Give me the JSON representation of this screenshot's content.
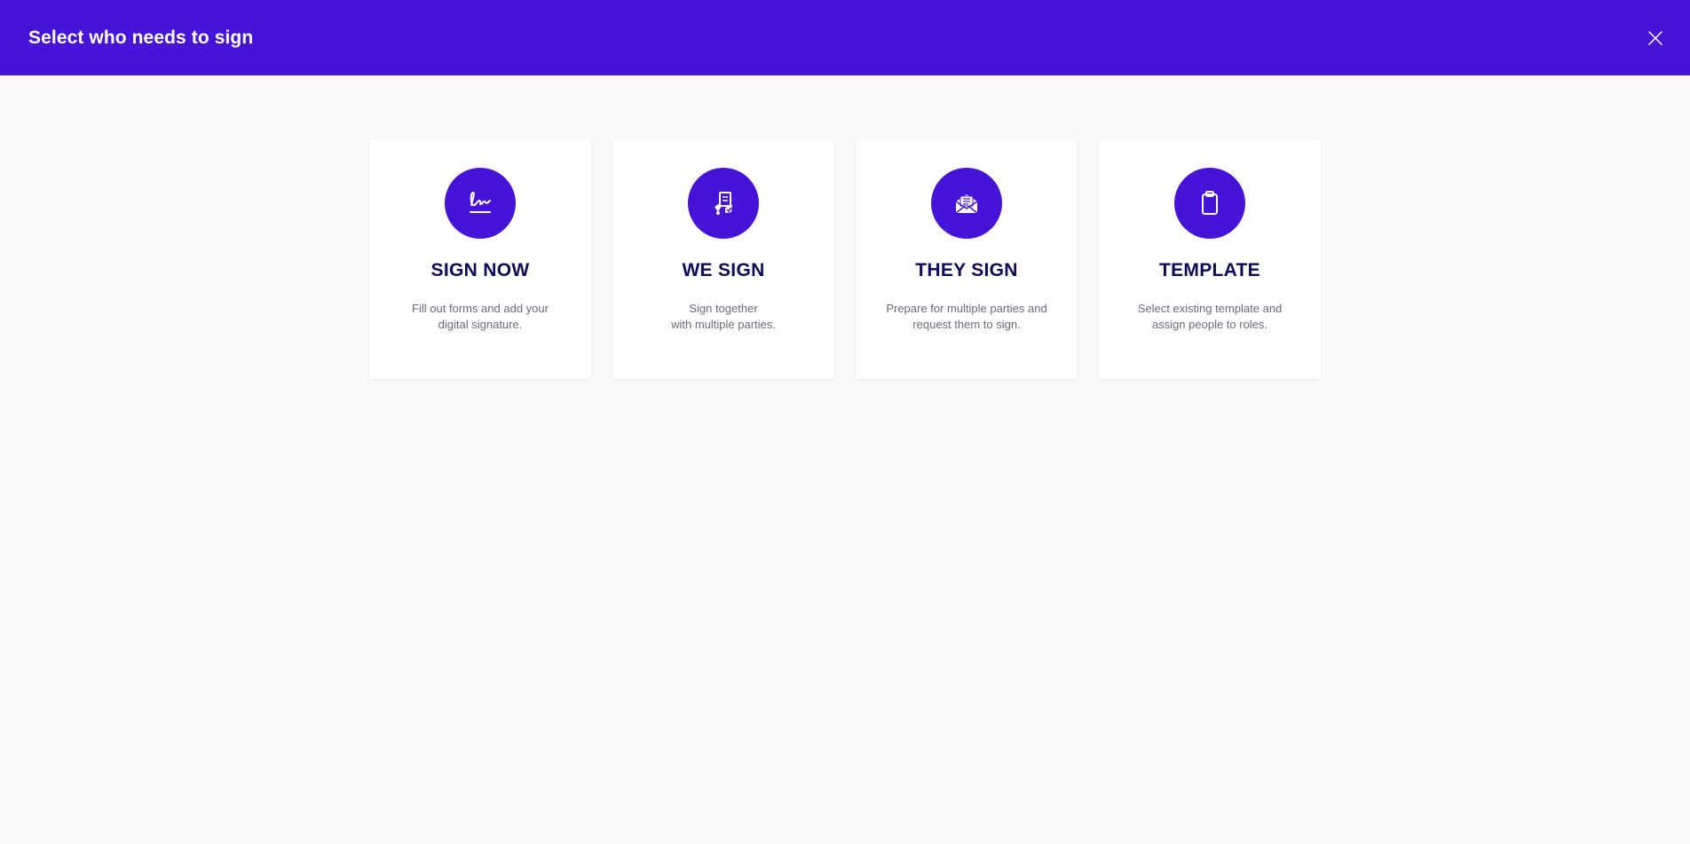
{
  "header": {
    "title": "Select who needs to sign",
    "close_icon": "close-icon"
  },
  "colors": {
    "brand": "#4614d9",
    "title": "#0f0a5c",
    "text_muted": "#6b6b78",
    "background": "#f9f9f9"
  },
  "cards": [
    {
      "title": "SIGN NOW",
      "description": "Fill out forms and add your\ndigital signature.",
      "icon": "signature-icon"
    },
    {
      "title": "WE SIGN",
      "description": "Sign together\nwith multiple parties.",
      "icon": "multi-party-sign-icon"
    },
    {
      "title": "THEY SIGN",
      "description": "Prepare for multiple parties and\nrequest them to sign.",
      "icon": "envelope-icon"
    },
    {
      "title": "TEMPLATE",
      "description": "Select existing template and\nassign people to roles.",
      "icon": "clipboard-icon"
    }
  ]
}
